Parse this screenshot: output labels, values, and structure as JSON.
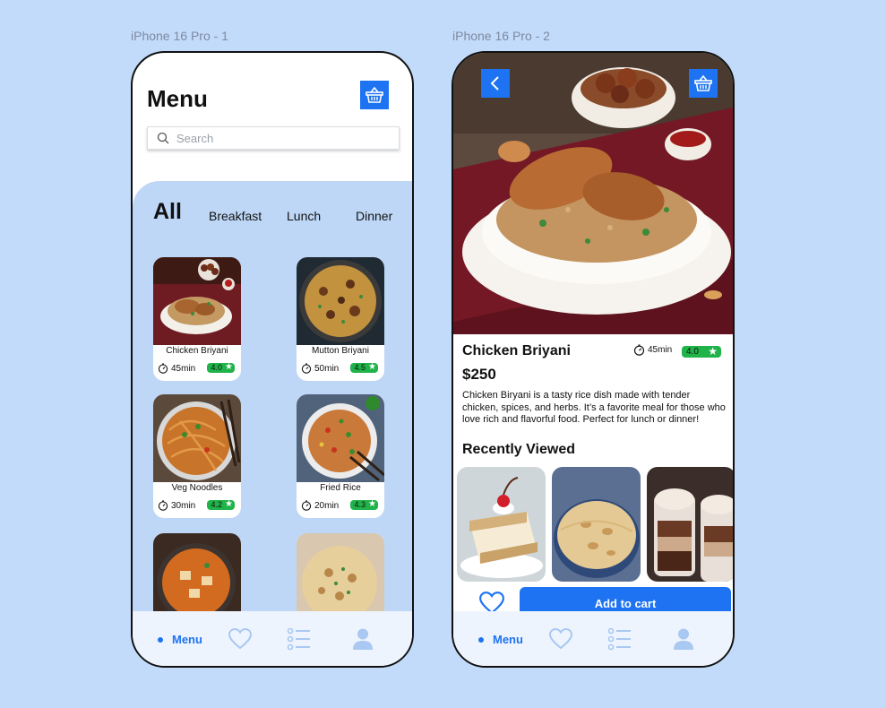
{
  "frames": {
    "left_label": "iPhone 16 Pro - 1",
    "right_label": "iPhone 16 Pro - 2"
  },
  "menu_screen": {
    "title": "Menu",
    "search_placeholder": "Search",
    "categories": [
      "All",
      "Breakfast",
      "Lunch",
      "Dinner"
    ],
    "active_category": "All",
    "items": [
      {
        "name": "Chicken Briyani",
        "time": "45min",
        "rating": "4.0"
      },
      {
        "name": "Mutton Briyani",
        "time": "50min",
        "rating": "4.5"
      },
      {
        "name": "Veg Noodles",
        "time": "30min",
        "rating": "4.2"
      },
      {
        "name": "Fried Rice",
        "time": "20min",
        "rating": "4.3"
      },
      {
        "name": "",
        "time": "",
        "rating": ""
      },
      {
        "name": "",
        "time": "",
        "rating": ""
      }
    ]
  },
  "detail_screen": {
    "title": "Chicken Briyani",
    "time": "45min",
    "rating": "4.0",
    "price": "$250",
    "description": "Chicken Biryani is a tasty rice dish made with tender chicken, spices, and herbs. It’s a favorite meal for those who love rich and flavorful food. Perfect for lunch or dinner!",
    "recently_viewed_label": "Recently Viewed",
    "add_to_cart_label": "Add to cart"
  },
  "tabbar": {
    "active_label": "Menu",
    "icons": [
      "heart-icon",
      "list-icon",
      "user-icon"
    ]
  },
  "colors": {
    "background": "#c3dbfa",
    "accent": "#1d73f2",
    "panel": "#bed7f7",
    "rating_badge": "#20b34a",
    "tab_inactive": "#a9c8f2"
  }
}
